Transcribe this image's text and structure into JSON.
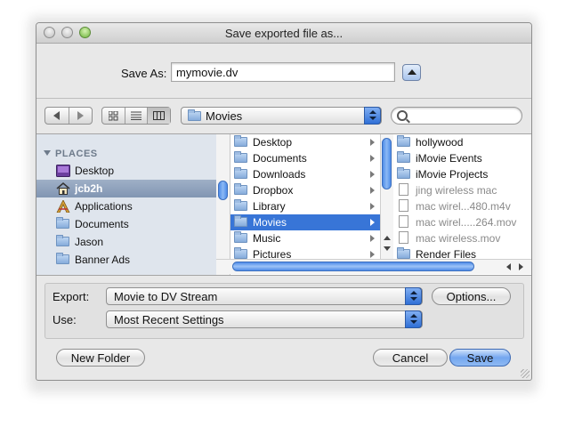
{
  "window": {
    "title": "Save exported file as..."
  },
  "save_as": {
    "label": "Save As:",
    "value": "mymovie.dv"
  },
  "location": {
    "selected": "Movies"
  },
  "search": {
    "placeholder": "",
    "value": ""
  },
  "sidebar": {
    "section": "PLACES",
    "items": [
      {
        "label": "Desktop",
        "icon": "desktop-icon",
        "selected": false
      },
      {
        "label": "jcb2h",
        "icon": "home-icon",
        "selected": true
      },
      {
        "label": "Applications",
        "icon": "applications-icon",
        "selected": false
      },
      {
        "label": "Documents",
        "icon": "folder-icon",
        "selected": false
      },
      {
        "label": "Jason",
        "icon": "folder-icon",
        "selected": false
      },
      {
        "label": "Banner Ads",
        "icon": "folder-icon",
        "selected": false
      }
    ]
  },
  "column1": [
    {
      "label": "Desktop",
      "selected": false
    },
    {
      "label": "Documents",
      "selected": false
    },
    {
      "label": "Downloads",
      "selected": false
    },
    {
      "label": "Dropbox",
      "selected": false
    },
    {
      "label": "Library",
      "selected": false
    },
    {
      "label": "Movies",
      "selected": true
    },
    {
      "label": "Music",
      "selected": false
    },
    {
      "label": "Pictures",
      "selected": false
    }
  ],
  "column2": [
    {
      "label": "hollywood",
      "type": "folder",
      "dim": false
    },
    {
      "label": "iMovie Events",
      "type": "folder",
      "dim": false
    },
    {
      "label": "iMovie Projects",
      "type": "folder",
      "dim": false
    },
    {
      "label": "jing wireless mac",
      "type": "file",
      "dim": true
    },
    {
      "label": "mac wirel...480.m4v",
      "type": "file",
      "dim": true
    },
    {
      "label": "mac wirel.....264.mov",
      "type": "file",
      "dim": true
    },
    {
      "label": "mac wireless.mov",
      "type": "file",
      "dim": true
    },
    {
      "label": "Render Files",
      "type": "folder",
      "dim": false
    }
  ],
  "export": {
    "label": "Export:",
    "value": "Movie to DV Stream",
    "options_button": "Options..."
  },
  "use": {
    "label": "Use:",
    "value": "Most Recent Settings"
  },
  "buttons": {
    "new_folder": "New Folder",
    "cancel": "Cancel",
    "save": "Save"
  },
  "colors": {
    "selection": "#3875d7",
    "sidebar": "#dfe5ed",
    "sidebar_selected": "#8d9fb9",
    "default_button": "#74a6ef"
  }
}
